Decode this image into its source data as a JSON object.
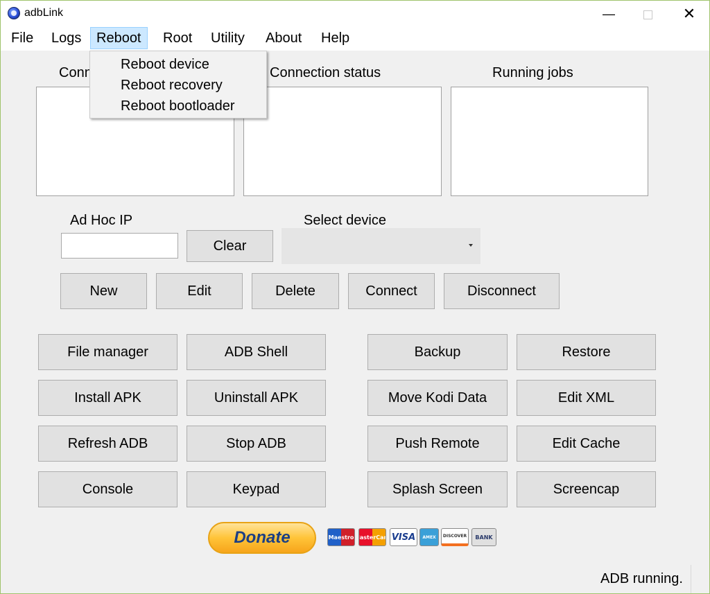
{
  "window": {
    "title": "adbLink",
    "controls": {
      "minimize": "—",
      "close": "✕"
    }
  },
  "menubar": {
    "items": [
      "File",
      "Logs",
      "Reboot",
      "Root",
      "Utility",
      "About",
      "Help"
    ],
    "active": "Reboot"
  },
  "reboot_menu": {
    "items": [
      "Reboot device",
      "Reboot recovery",
      "Reboot bootloader"
    ]
  },
  "panels": {
    "connected_label": "Conn",
    "connection_status_label": "Connection status",
    "running_jobs_label": "Running jobs"
  },
  "adhoc": {
    "label": "Ad Hoc IP",
    "value": "",
    "clear_label": "Clear"
  },
  "select_device": {
    "label": "Select device",
    "value": ""
  },
  "device_buttons": {
    "new": "New",
    "edit": "Edit",
    "delete": "Delete",
    "connect": "Connect",
    "disconnect": "Disconnect"
  },
  "actions": {
    "file_manager": "File manager",
    "adb_shell": "ADB Shell",
    "backup": "Backup",
    "restore": "Restore",
    "install_apk": "Install APK",
    "uninstall_apk": "Uninstall APK",
    "move_kodi_data": "Move Kodi Data",
    "edit_xml": "Edit XML",
    "refresh_adb": "Refresh ADB",
    "stop_adb": "Stop ADB",
    "push_remote": "Push Remote",
    "edit_cache": "Edit Cache",
    "console": "Console",
    "keypad": "Keypad",
    "splash_screen": "Splash Screen",
    "screencap": "Screencap"
  },
  "donate": {
    "label": "Donate",
    "cards": [
      "Maestro",
      "MasterCard",
      "VISA",
      "AMEX",
      "DISCOVER",
      "BANK"
    ]
  },
  "status": {
    "text": "ADB running."
  },
  "colors": {
    "window_bg": "#f0f0f0",
    "button_bg": "#e1e1e1",
    "menu_highlight": "#cce8ff",
    "donate_gold": "#ffc439",
    "donate_text": "#1c3f84"
  }
}
